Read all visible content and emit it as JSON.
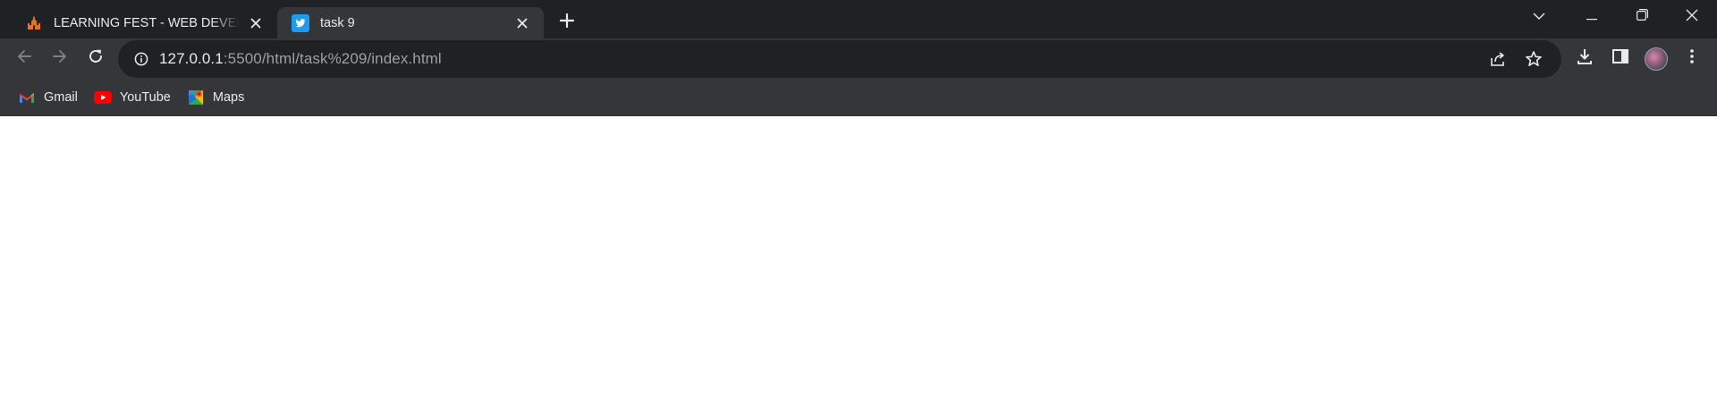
{
  "tabs": [
    {
      "title": "LEARNING FEST - WEB DEVELOPMENT",
      "favicon": "fire-castle-icon",
      "active": false
    },
    {
      "title": "task 9",
      "favicon": "twitter-bird-icon",
      "active": true
    }
  ],
  "toolbar": {
    "url_host": "127.0.0.1",
    "url_rest": ":5500/html/task%209/index.html"
  },
  "bookmarks": [
    {
      "label": "Gmail",
      "icon": "gmail-icon"
    },
    {
      "label": "YouTube",
      "icon": "youtube-icon"
    },
    {
      "label": "Maps",
      "icon": "maps-icon"
    }
  ],
  "colors": {
    "tabstrip_bg": "#202124",
    "toolbar_bg": "#35363a",
    "omnibox_bg": "#202124",
    "text": "#e8eaed",
    "muted_text": "#9aa0a6",
    "page_bg": "#ffffff"
  }
}
